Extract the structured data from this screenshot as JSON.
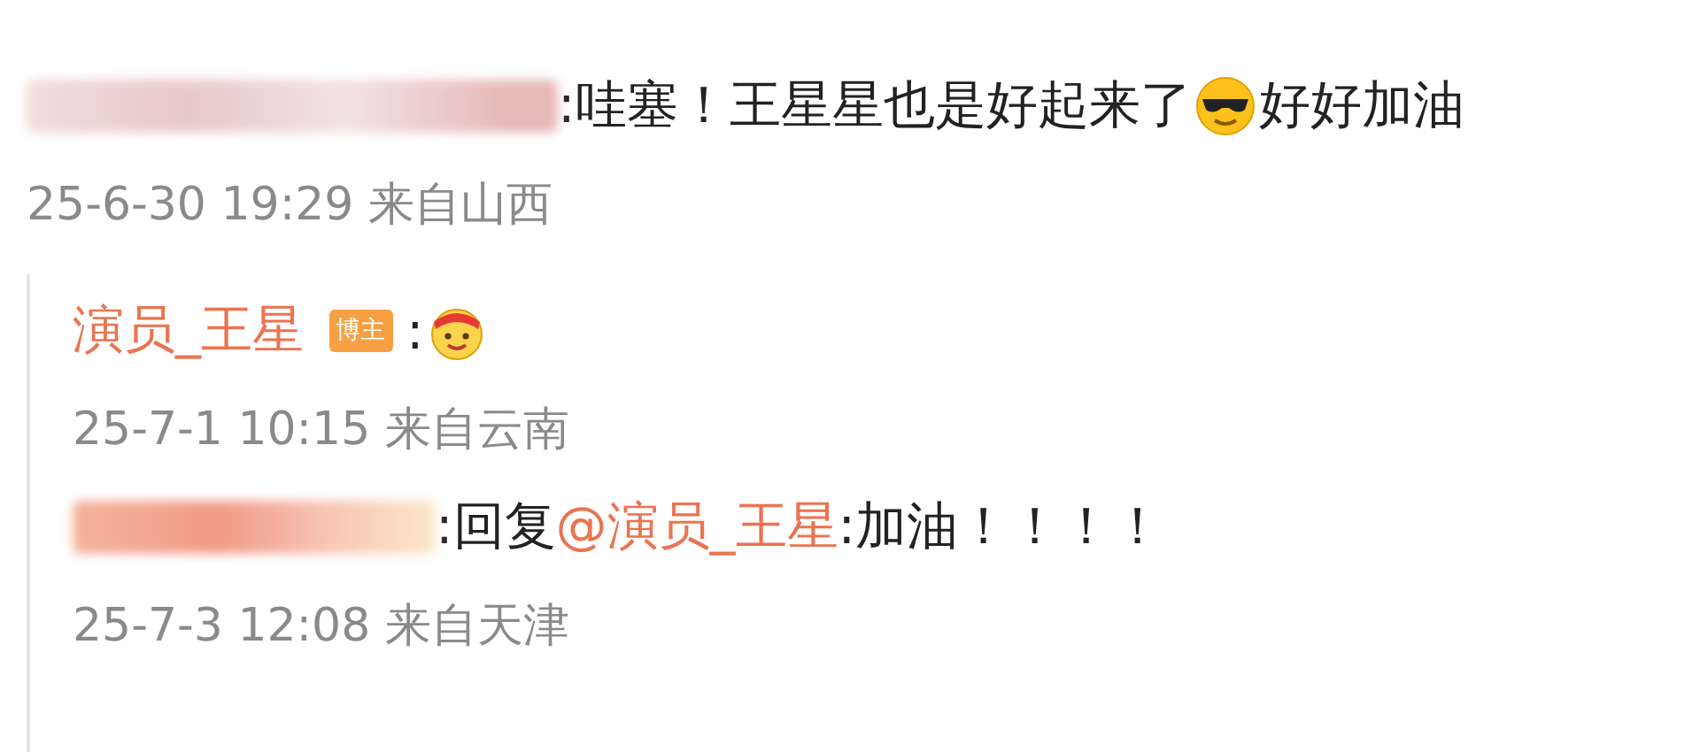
{
  "comment": {
    "author": {
      "kind": "blurred"
    },
    "parts": [
      {
        "kind": "text",
        "text": ":哇塞！王星星也是好起来了"
      },
      {
        "kind": "sunglasses"
      },
      {
        "kind": "text",
        "text": "好好加油"
      }
    ],
    "time": "25-6-30 19:29 来自山西",
    "replies": [
      {
        "author": {
          "kind": "name",
          "text": "演员_王星",
          "badge": "博主"
        },
        "parts": [
          {
            "kind": "text",
            "text": ":"
          },
          {
            "kind": "cheer"
          }
        ],
        "time": "25-7-1 10:15 来自云南"
      },
      {
        "author": {
          "kind": "blurred"
        },
        "parts": [
          {
            "kind": "text",
            "text": ":回复"
          },
          {
            "kind": "mention",
            "text": "@演员_王星"
          },
          {
            "kind": "text",
            "text": ":加油！！！！"
          }
        ],
        "time": "25-7-3 12:08 来自天津"
      }
    ]
  }
}
